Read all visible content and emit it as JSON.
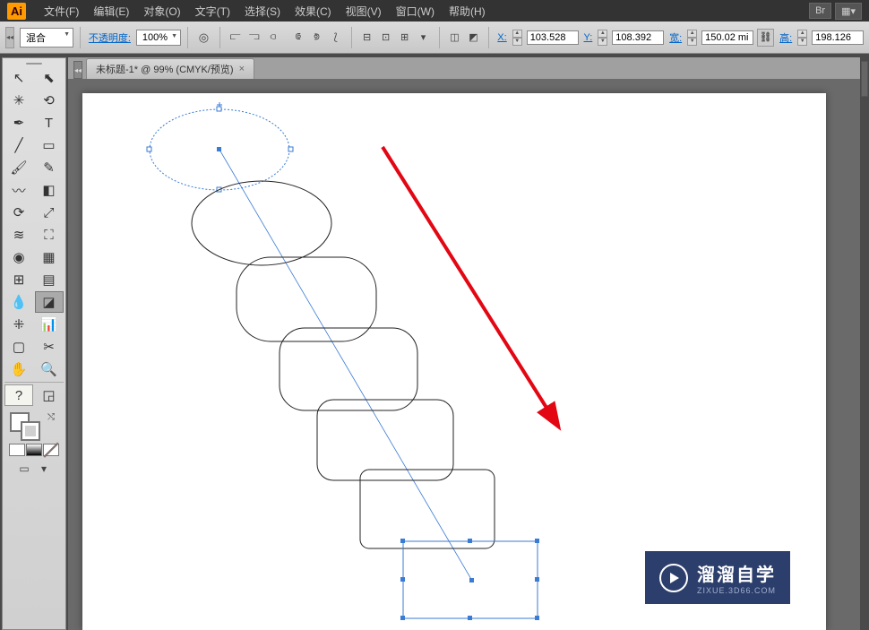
{
  "app": {
    "logo": "Ai"
  },
  "menu": {
    "items": [
      "文件(F)",
      "编辑(E)",
      "对象(O)",
      "文字(T)",
      "选择(S)",
      "效果(C)",
      "视图(V)",
      "窗口(W)",
      "帮助(H)"
    ],
    "right": [
      "Br",
      "▦▾"
    ]
  },
  "control": {
    "mode": "混合",
    "opacity_label": "不透明度:",
    "opacity_value": "100%",
    "x_label": "X:",
    "x_value": "103.528",
    "y_label": "Y:",
    "y_value": "108.392",
    "w_label": "宽:",
    "w_value": "150.02 mi",
    "h_label": "高:",
    "h_value": "198.126"
  },
  "tools": {
    "rows": [
      [
        "selection-tool",
        "↖",
        "direct-selection-tool",
        "⬉"
      ],
      [
        "magic-wand-tool",
        "✳",
        "lasso-tool",
        "⟲"
      ],
      [
        "pen-tool",
        "✒",
        "type-tool",
        "T"
      ],
      [
        "line-tool",
        "╱",
        "rectangle-tool",
        "▭"
      ],
      [
        "paintbrush-tool",
        "🖌",
        "pencil-tool",
        "✎"
      ],
      [
        "blob-brush-tool",
        "〰",
        "eraser-tool",
        "◧"
      ],
      [
        "rotate-tool",
        "⟳",
        "scale-tool",
        "⤢"
      ],
      [
        "width-tool",
        "≋",
        "free-transform-tool",
        "⛶"
      ],
      [
        "shape-builder-tool",
        "◉",
        "perspective-tool",
        "▦"
      ],
      [
        "mesh-tool",
        "⊞",
        "gradient-tool",
        "▤"
      ],
      [
        "eyedropper-tool",
        "💧",
        "blend-tool",
        "◪"
      ],
      [
        "symbol-sprayer-tool",
        "⁜",
        "graph-tool",
        "📊"
      ],
      [
        "artboard-tool",
        "▢",
        "slice-tool",
        "✂"
      ],
      [
        "hand-tool",
        "✋",
        "zoom-tool",
        "🔍"
      ]
    ],
    "help": "?"
  },
  "document": {
    "tab_title": "未标题-1* @ 99% (CMYK/预览)",
    "close": "×"
  },
  "watermark": {
    "cn": "溜溜自学",
    "en": "ZIXUE.3D66.COM"
  }
}
